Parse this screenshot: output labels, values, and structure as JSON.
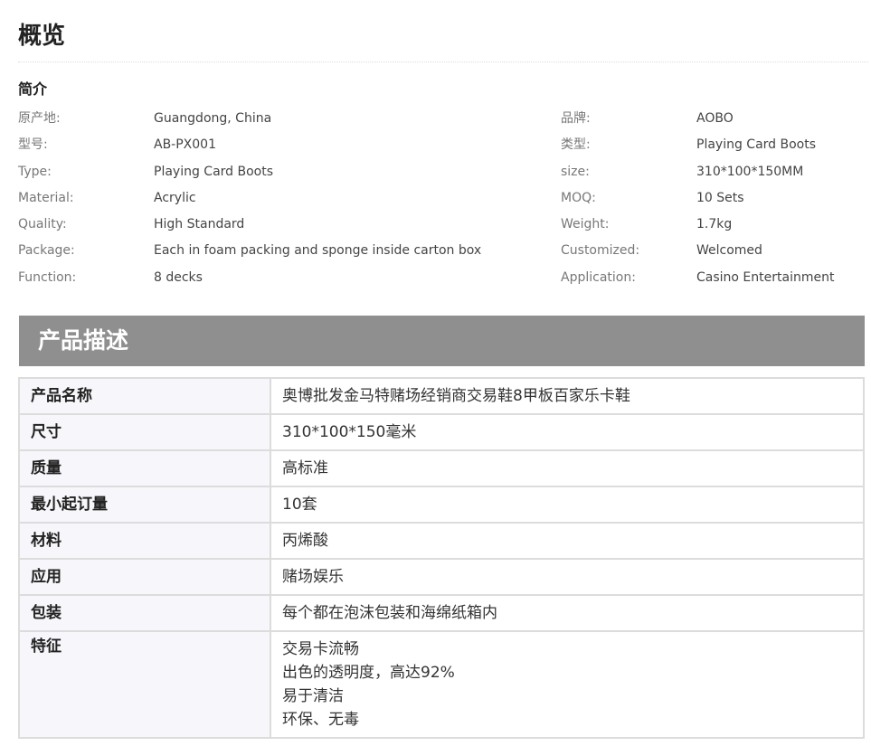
{
  "overview": {
    "title": "概览"
  },
  "intro": {
    "heading": "简介",
    "rows": [
      {
        "left_label": "原产地:",
        "left_value": "Guangdong, China",
        "right_label": "品牌:",
        "right_value": "AOBO"
      },
      {
        "left_label": "型号:",
        "left_value": "AB-PX001",
        "right_label": "类型:",
        "right_value": "Playing Card Boots"
      },
      {
        "left_label": "Type:",
        "left_value": "Playing Card Boots",
        "right_label": "size:",
        "right_value": "310*100*150MM"
      },
      {
        "left_label": "Material:",
        "left_value": "Acrylic",
        "right_label": "MOQ:",
        "right_value": "10 Sets"
      },
      {
        "left_label": "Quality:",
        "left_value": "High Standard",
        "right_label": "Weight:",
        "right_value": "1.7kg"
      },
      {
        "left_label": "Package:",
        "left_value": "Each in foam packing and sponge inside carton box",
        "right_label": "Customized:",
        "right_value": "Welcomed"
      },
      {
        "left_label": "Function:",
        "left_value": "8 decks",
        "right_label": "Application:",
        "right_value": "Casino Entertainment"
      }
    ]
  },
  "description": {
    "banner_title": "产品描述",
    "rows": [
      {
        "key": "产品名称",
        "value": "奥博批发金马特赌场经销商交易鞋8甲板百家乐卡鞋"
      },
      {
        "key": "尺寸",
        "value": "310*100*150毫米"
      },
      {
        "key": "质量",
        "value": "高标准"
      },
      {
        "key": "最小起订量",
        "value": "10套"
      },
      {
        "key": "材料",
        "value": "丙烯酸"
      },
      {
        "key": "应用",
        "value": "赌场娱乐"
      },
      {
        "key": "包装",
        "value": "每个都在泡沫包装和海绵纸箱内"
      }
    ],
    "features": {
      "key": "特征",
      "lines": [
        "交易卡流畅",
        "出色的透明度，高达92%",
        "易于清洁",
        "环保、无毒"
      ]
    }
  }
}
